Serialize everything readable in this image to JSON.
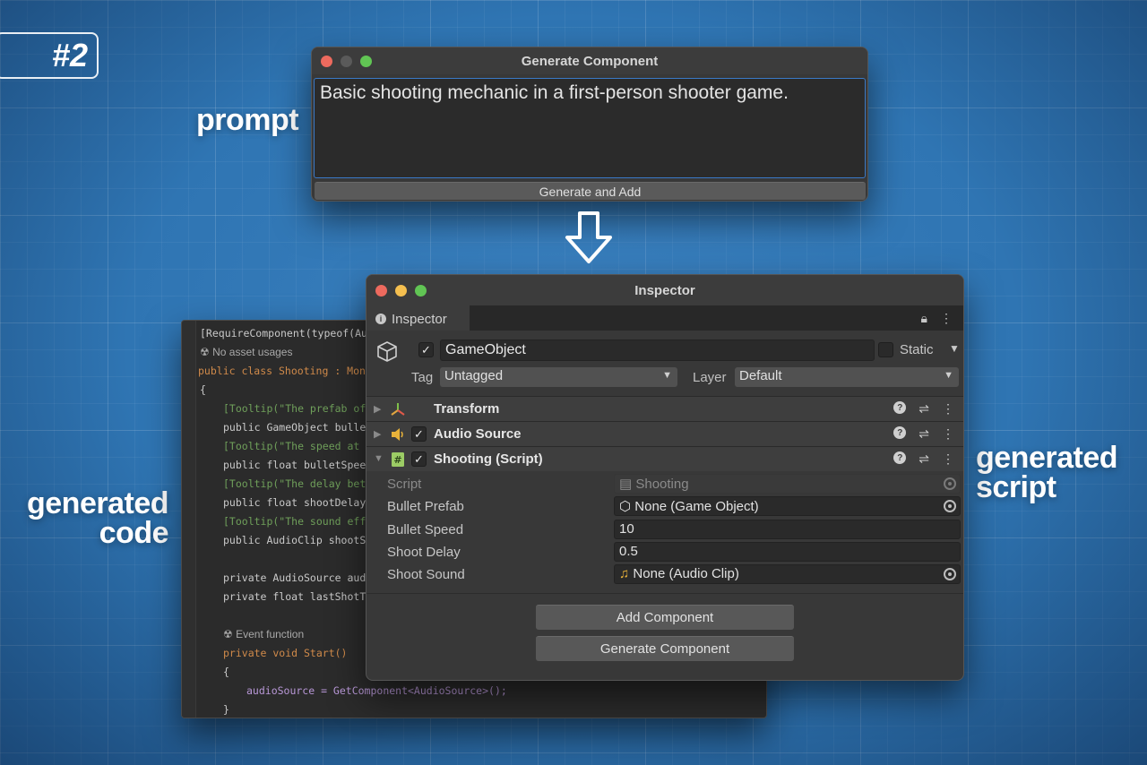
{
  "badge": "#2",
  "labels": {
    "prompt": "prompt",
    "generated_code": [
      "generated",
      "code"
    ],
    "generated_script": [
      "generated",
      "script"
    ]
  },
  "generate_window": {
    "title": "Generate Component",
    "prompt_text": "Basic shooting mechanic in a first-person shooter game.",
    "button": "Generate and Add"
  },
  "code": {
    "lines": [
      "[RequireComponent(typeof(Audi",
      "No asset usages",
      "public class Shooting : MonoB",
      "{",
      "[Tooltip(\"The prefab of t",
      "public GameObject bulletP",
      "[Tooltip(\"The speed at wh",
      "public float bulletSpeed",
      "[Tooltip(\"The delay betwe",
      "public float shootDelay =",
      "[Tooltip(\"The sound effec",
      "public AudioClip shootSou",
      "private AudioSource audi",
      "private float lastShotTim",
      "Event function",
      "private void Start()",
      "{",
      "audioSource = GetComponent<AudioSource>();",
      "}"
    ]
  },
  "inspector": {
    "title": "Inspector",
    "tab": "Inspector",
    "gameobject_name": "GameObject",
    "static_label": "Static",
    "tag_label": "Tag",
    "tag_value": "Untagged",
    "layer_label": "Layer",
    "layer_value": "Default",
    "components": [
      {
        "name": "Transform",
        "icon": "transform-icon"
      },
      {
        "name": "Audio Source",
        "icon": "speaker-icon"
      },
      {
        "name": "Shooting (Script)",
        "icon": "script-icon"
      }
    ],
    "fields": [
      {
        "label": "Script",
        "value": "Shooting"
      },
      {
        "label": "Bullet Prefab",
        "value": "None (Game Object)"
      },
      {
        "label": "Bullet Speed",
        "value": "10"
      },
      {
        "label": "Shoot Delay",
        "value": "0.5"
      },
      {
        "label": "Shoot Sound",
        "value": "None (Audio Clip)"
      }
    ],
    "add_component": "Add Component",
    "generate_component": "Generate Component"
  }
}
